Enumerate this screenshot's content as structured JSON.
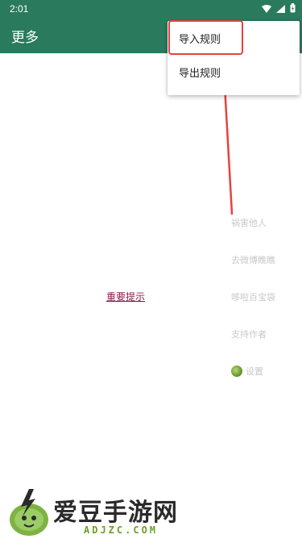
{
  "status_bar": {
    "time": "2:01",
    "icons": [
      "wifi-icon",
      "signal-icon",
      "battery-icon"
    ]
  },
  "toolbar": {
    "title": "更多"
  },
  "popup_menu": {
    "items": [
      {
        "label": "导入规则",
        "highlighted": true
      },
      {
        "label": "导出规则",
        "highlighted": false
      }
    ]
  },
  "main": {
    "notice_link": "重要提示"
  },
  "side_menu": {
    "items": [
      {
        "label": "祸害他人"
      },
      {
        "label": "去微博瞧瞧"
      },
      {
        "label": "哆啦百宝袋"
      },
      {
        "label": "支持作者"
      },
      {
        "label": "设置",
        "icon": "settings-ball-icon"
      }
    ]
  },
  "watermark": {
    "title": "爱豆手游网",
    "subtitle": "ADJZC.COM"
  },
  "colors": {
    "toolbar": "#2a7a5e",
    "highlight": "#e8413c",
    "link": "#8a1b4a",
    "faded_text": "#c9c9c9",
    "brand_green": "#6aa12a"
  }
}
